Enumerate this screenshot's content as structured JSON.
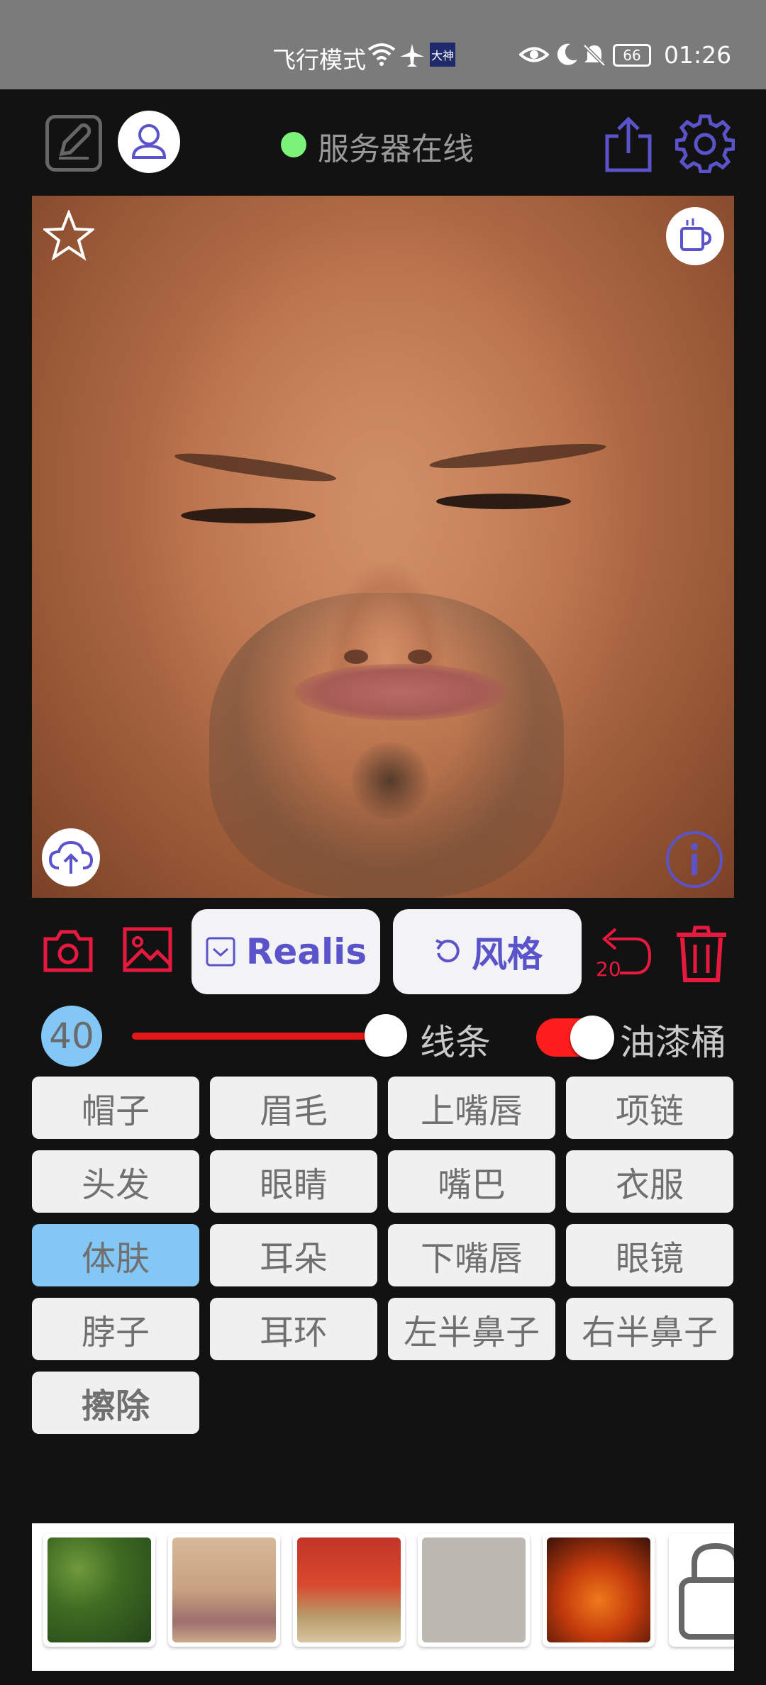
{
  "status_bar": {
    "airplane_mode_label": "飞行模式",
    "badge_label": "大神",
    "battery_level": "66",
    "time": "01:26"
  },
  "header": {
    "server_status": "服务器在线",
    "server_status_color": "#7df27a",
    "accent_color": "#5b53c9"
  },
  "tools": {
    "realis_label": "Realis",
    "style_label": "风格",
    "undo_count": "20",
    "danger_color": "#e8193f"
  },
  "brush": {
    "size": "40",
    "slider_value": 0.9,
    "lines_label": "线条",
    "bucket_label": "油漆桶",
    "bucket_enabled": true
  },
  "parts": [
    {
      "label": "帽子"
    },
    {
      "label": "眉毛"
    },
    {
      "label": "上嘴唇"
    },
    {
      "label": "项链"
    },
    {
      "label": "头发"
    },
    {
      "label": "眼睛"
    },
    {
      "label": "嘴巴"
    },
    {
      "label": "衣服"
    },
    {
      "label": "体肤",
      "selected": true
    },
    {
      "label": "耳朵"
    },
    {
      "label": "下嘴唇"
    },
    {
      "label": "眼镜"
    },
    {
      "label": "脖子"
    },
    {
      "label": "耳环"
    },
    {
      "label": "左半鼻子"
    },
    {
      "label": "右半鼻子"
    },
    {
      "label": "擦除"
    }
  ],
  "textures": [
    "green-foliage-texture",
    "flower-petal-texture",
    "red-blossom-texture",
    "gray-watermark-texture",
    "fire-texture",
    "lock-icon"
  ]
}
